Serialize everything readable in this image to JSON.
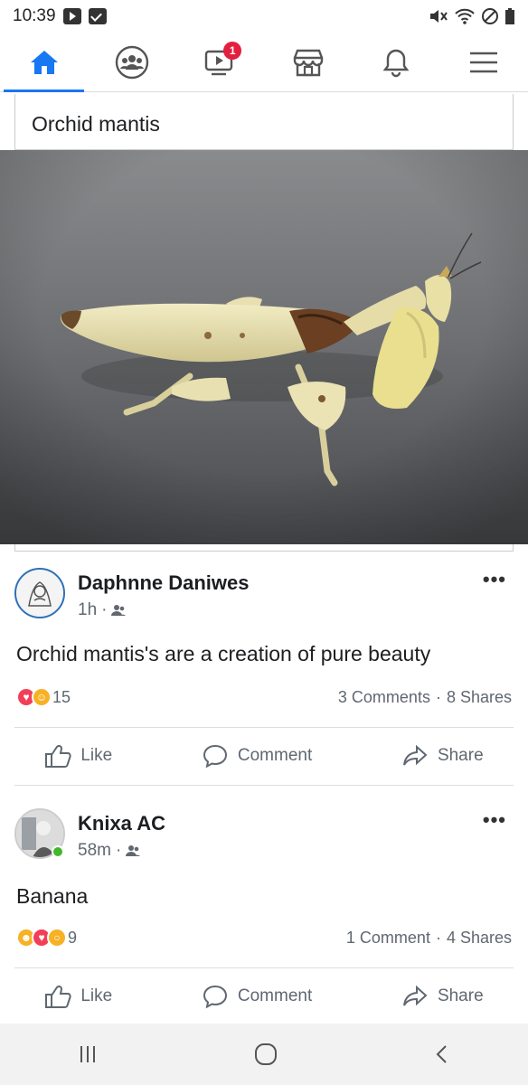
{
  "status_bar": {
    "time": "10:39"
  },
  "nav": {
    "items": [
      {
        "name": "home",
        "icon": "home-icon"
      },
      {
        "name": "groups",
        "icon": "groups-icon"
      },
      {
        "name": "watch",
        "icon": "watch-icon",
        "badge": "1"
      },
      {
        "name": "marketplace",
        "icon": "marketplace-icon"
      },
      {
        "name": "notifications",
        "icon": "bell-icon"
      },
      {
        "name": "menu",
        "icon": "hamburger-menu-icon"
      }
    ],
    "active_index": 0,
    "accent_color": "#1877f2",
    "badge_color": "#e41e3f"
  },
  "shared_post": {
    "title": "Orchid mantis"
  },
  "posts": [
    {
      "author": "Daphnne Daniwes",
      "time": "1h",
      "privacy_icon": "friends-icon",
      "text": "Orchid mantis's are a creation of pure beauty",
      "reactions": [
        "love",
        "care"
      ],
      "reaction_count": "15",
      "comments": "3 Comments",
      "shares": "8 Shares"
    },
    {
      "author": "Knixa AC",
      "time": "58m",
      "privacy_icon": "friends-icon",
      "online": true,
      "text": "Banana",
      "reactions": [
        "haha",
        "love",
        "wow"
      ],
      "reaction_count": "9",
      "comments": "1 Comment",
      "shares": "4 Shares"
    }
  ],
  "actions": {
    "like": "Like",
    "comment": "Comment",
    "share": "Share"
  }
}
